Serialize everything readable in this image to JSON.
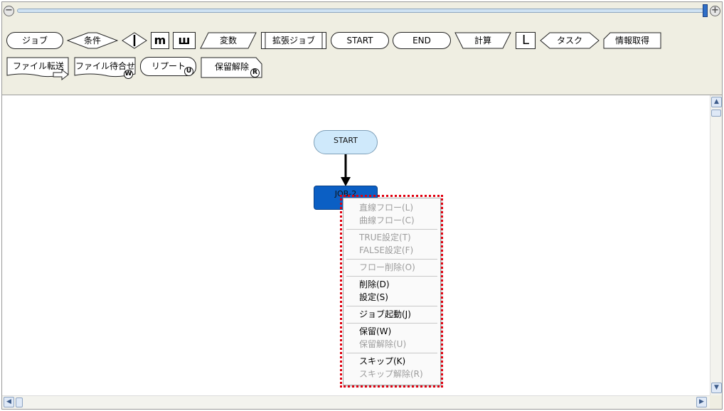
{
  "zoom": {
    "minus_label": "−",
    "plus_label": "+",
    "level": 1.0
  },
  "palette": {
    "row1": {
      "job": "ジョブ",
      "condition": "条件",
      "parallel_i": "I",
      "parallel_m": "m",
      "parallel_w": "ш",
      "variable": "変数",
      "extended_job": "拡張ジョブ",
      "start": "START",
      "end": "END",
      "calc": "計算",
      "loop": "L",
      "task": "タスク",
      "info_get": "情報取得"
    },
    "row2": {
      "file_transfer": "ファイル転送",
      "file_wait": "ファイル待合せ",
      "file_wait_badge": "W",
      "repeat": "リプート",
      "repeat_badge": "U",
      "hold_release": "保留解除",
      "hold_release_badge": "R"
    }
  },
  "canvas": {
    "start_node": "START",
    "job_node": "JOB-2"
  },
  "context_menu": {
    "items": [
      {
        "label": "直線フロー(L)",
        "enabled": false
      },
      {
        "label": "曲線フロー(C)",
        "enabled": false
      },
      {
        "label": "TRUE設定(T)",
        "enabled": false
      },
      {
        "label": "FALSE設定(F)",
        "enabled": false
      },
      {
        "label": "フロー削除(O)",
        "enabled": false
      },
      {
        "label": "削除(D)",
        "enabled": true
      },
      {
        "label": "設定(S)",
        "enabled": true
      },
      {
        "label": "ジョブ起動(J)",
        "enabled": true
      },
      {
        "label": "保留(W)",
        "enabled": true
      },
      {
        "label": "保留解除(U)",
        "enabled": false
      },
      {
        "label": "スキップ(K)",
        "enabled": true
      },
      {
        "label": "スキップ解除(R)",
        "enabled": false
      }
    ]
  },
  "colors": {
    "highlight": "#e0000f",
    "job_node": "#0b5fc4",
    "start_node": "#cfe9fb"
  }
}
